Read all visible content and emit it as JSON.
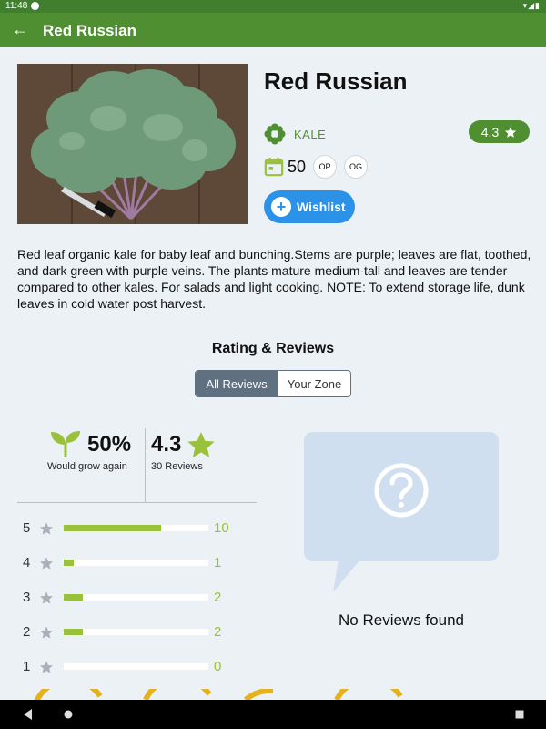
{
  "status_bar": {
    "time": "11:48"
  },
  "app_bar": {
    "title": "Red Russian"
  },
  "plant": {
    "name": "Red Russian",
    "category": "KALE",
    "rating": "4.3",
    "days": "50",
    "tags": [
      "OP",
      "OG"
    ],
    "wishlist_label": "Wishlist",
    "description": "Red leaf organic kale for baby leaf and bunching.Stems are purple; leaves are flat, toothed, and dark green with purple veins. The plants mature medium-tall and leaves are tender compared to other kales. For salads and light cooking. NOTE: To extend storage life, dunk leaves in cold water post harvest."
  },
  "reviews": {
    "title": "Rating & Reviews",
    "tabs": [
      "All  Reviews",
      "Your Zone"
    ],
    "active_tab": 0,
    "grow_again_pct": "50%",
    "grow_again_label": "Would grow again",
    "average": "4.3",
    "count_label": "30 Reviews",
    "breakdown": [
      {
        "stars": "5",
        "count": "10",
        "fraction": 0.67
      },
      {
        "stars": "4",
        "count": "1",
        "fraction": 0.07
      },
      {
        "stars": "3",
        "count": "2",
        "fraction": 0.13
      },
      {
        "stars": "2",
        "count": "2",
        "fraction": 0.13
      },
      {
        "stars": "1",
        "count": "0",
        "fraction": 0.0
      }
    ],
    "empty_message": "No Reviews found"
  },
  "colors": {
    "primary_green": "#4f8f32",
    "accent_lime": "#9ac13b",
    "wishlist_blue": "#2b92e8"
  },
  "icons": {
    "back": "arrow-left-icon",
    "category": "flower-icon",
    "calendar": "calendar-icon",
    "sprout": "sprout-icon",
    "star": "star-icon",
    "question": "question-icon"
  }
}
